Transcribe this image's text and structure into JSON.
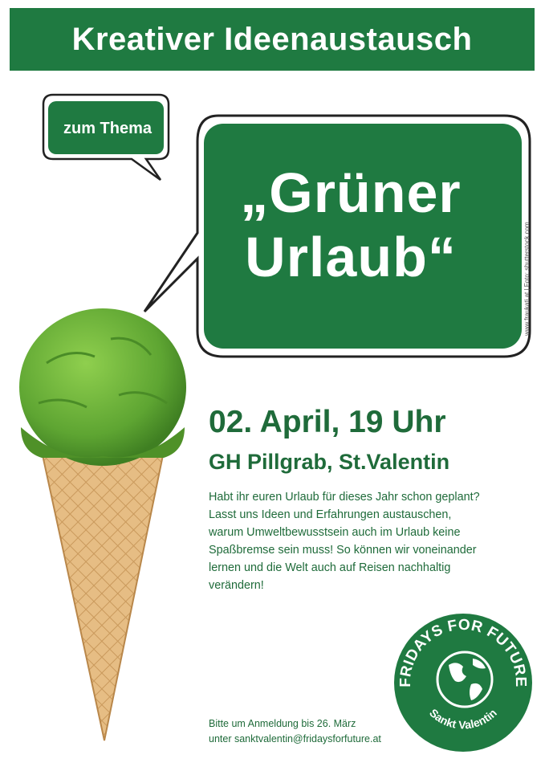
{
  "header": {
    "title": "Kreativer Ideenaustausch"
  },
  "bubble_small": {
    "text": "zum Thema"
  },
  "bubble_big": {
    "line1": "„Grüner",
    "line2": "Urlaub“"
  },
  "credit": "www.fraukati.at | Foto: shutterstock.com",
  "event": {
    "date": "02. April, 19 Uhr",
    "location": "GH Pillgrab, St.Valentin",
    "description": [
      "Habt ihr euren Urlaub für dieses Jahr schon geplant?",
      "Lasst uns Ideen und Erfahrungen austauschen,",
      "warum Umweltbewusstsein auch im Urlaub keine",
      "Spaßbremse sein muss! So können wir voneinander",
      "lernen und die Welt auch auf Reisen nachhaltig",
      "verändern!"
    ]
  },
  "registration": {
    "line1": "Bitte um Anmeldung bis 26. März",
    "line2": "unter sanktvalentin@fridaysforfuture.at"
  },
  "logo": {
    "top_text": "FRIDAYS FOR FUTURE",
    "bottom_text": "Sankt Valentin",
    "icon": "globe-icon"
  },
  "colors": {
    "brand_green": "#1f7a41",
    "text_green": "#1f6b3a",
    "ice_green": "#6db33f",
    "cone": "#e3b77c"
  }
}
